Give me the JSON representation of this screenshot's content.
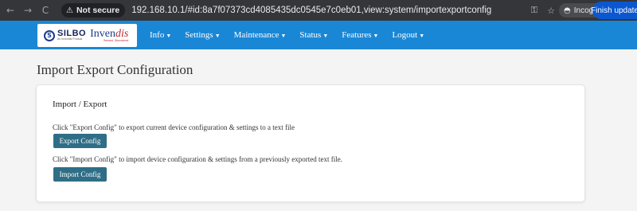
{
  "browser": {
    "back_icon": "←",
    "forward_icon": "→",
    "reload_icon": "C",
    "security_label": "Not secure",
    "url": "192.168.10.1/#id:8a7f07373cd4085435dc0545e7c0eb01,view:system/importexportconfig",
    "incognito_label": "Incognito",
    "finish_update_label": "Finish update"
  },
  "logo": {
    "silbo": "SILBO",
    "silbo_sub": "An Invendis Product",
    "invendis_main": "Inven",
    "invendis_accent": "dis",
    "tagline": "Sensed, Discovered"
  },
  "nav": {
    "items": [
      {
        "label": "Info"
      },
      {
        "label": "Settings"
      },
      {
        "label": "Maintenance"
      },
      {
        "label": "Status"
      },
      {
        "label": "Features"
      },
      {
        "label": "Logout"
      }
    ]
  },
  "page": {
    "title": "Import Export Configuration",
    "card": {
      "title": "Import / Export",
      "export_description": "Click \"Export Config\" to export current device configuration & settings to a text file",
      "export_button": "Export Config",
      "import_description": "Click \"Import Config\" to import device configuration & settings from a previously exported text file.",
      "import_button": "Import Config"
    }
  },
  "colors": {
    "navbar": "#1a87d6",
    "button": "#2f6e86",
    "chrome": "#35363a"
  }
}
